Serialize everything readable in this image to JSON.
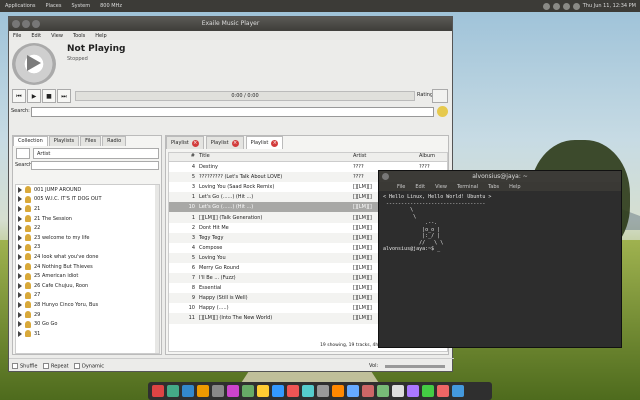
{
  "top_panel": {
    "menus": [
      "Applications",
      "Places",
      "System"
    ],
    "cpu": "800 MHz",
    "clock": "Thu Jun 11, 12:34 PM"
  },
  "player": {
    "title": "Exaile Music Player",
    "menu": [
      "File",
      "Edit",
      "View",
      "Tools",
      "Help"
    ],
    "now_playing": {
      "title": "Not Playing",
      "subtitle": "Stopped"
    },
    "time": "0:00 / 0:00",
    "rating_label": "Rating:",
    "search_label": "Search:",
    "left_tabs": [
      "Collection",
      "Playlists",
      "Files",
      "Radio"
    ],
    "filter_value": "Artist",
    "left_search_label": "Search:",
    "collection": [
      "001 JUMP AROUND",
      "005 W.I.C. IT'S IT DOG OUT",
      "21",
      "21 The Session",
      "22",
      "23 welcome to my life",
      "23",
      "24 look what you've done",
      "24 Nothing But Thieves",
      "25 American idiot",
      "26 Cafe Chujuu, Roon",
      "27",
      "28 Hunyo Cinco Yoru, Bus",
      "29",
      "30 Go Go",
      "31"
    ],
    "playlist_tabs": [
      "Playlist",
      "Playlist",
      "Playlist"
    ],
    "columns": [
      "#",
      "Title",
      "Artist",
      "Album"
    ],
    "tracks": [
      {
        "n": "4",
        "title": "Destiny",
        "artist": "????",
        "album": "????"
      },
      {
        "n": "5",
        "title": "????????? (Let's Talk About LOVE)",
        "artist": "????",
        "album": "????"
      },
      {
        "n": "3",
        "title": "Loving You (Saad Rock Remix)",
        "artist": "[][LM][]",
        "album": "????"
      },
      {
        "n": "1",
        "title": "Let's Go (......) (Hit ...)",
        "artist": "[][LM][]",
        "album": "????"
      },
      {
        "n": "10",
        "title": "Let's Go (......) (Hit ...)",
        "artist": "[][LM][]",
        "album": "????"
      },
      {
        "n": "1",
        "title": "[][LM][] (Talk Generation)",
        "artist": "[][LM][]",
        "album": "????"
      },
      {
        "n": "2",
        "title": "Dont Hit Me",
        "artist": "[][LM][]",
        "album": "????"
      },
      {
        "n": "3",
        "title": "Tegy Tegy",
        "artist": "[][LM][]",
        "album": "????"
      },
      {
        "n": "4",
        "title": "Compose",
        "artist": "[][LM][]",
        "album": "????"
      },
      {
        "n": "5",
        "title": "Loving You",
        "artist": "[][LM][]",
        "album": "????"
      },
      {
        "n": "6",
        "title": "Merry Go Round",
        "artist": "[][LM][]",
        "album": "????"
      },
      {
        "n": "7",
        "title": "I'll Be ... (Fuzz)",
        "artist": "[][LM][]",
        "album": "????"
      },
      {
        "n": "8",
        "title": "Essential",
        "artist": "[][LM][]",
        "album": "????"
      },
      {
        "n": "9",
        "title": "Happy (Still is Well)",
        "artist": "[][LM][]",
        "album": "????"
      },
      {
        "n": "10",
        "title": "Happy (.....)",
        "artist": "[][LM][]",
        "album": "????"
      },
      {
        "n": "11",
        "title": "[][LM][] (Into The New World)",
        "artist": "[][LM][]",
        "album": "????"
      }
    ],
    "status": "19 showing, 19 tracks, 4h 32m total, 4h 32m selected",
    "shuffle": "Shuffle",
    "repeat": "Repeat",
    "dynamic": "Dynamic",
    "volume_label": "Vol:"
  },
  "terminal": {
    "title": "alvonsius@jaya: ~",
    "menu": [
      "File",
      "Edit",
      "View",
      "Terminal",
      "Tabs",
      "Help"
    ],
    "lines": [
      "< Hello Linux, Hello World! Ubuntu >",
      " ---------------------------------",
      "         \\",
      "          \\",
      "              .--.",
      "             |o_o |",
      "             |:_/ |",
      "            //   \\ \\",
      "alvonsius@jaya:~$ _"
    ]
  }
}
